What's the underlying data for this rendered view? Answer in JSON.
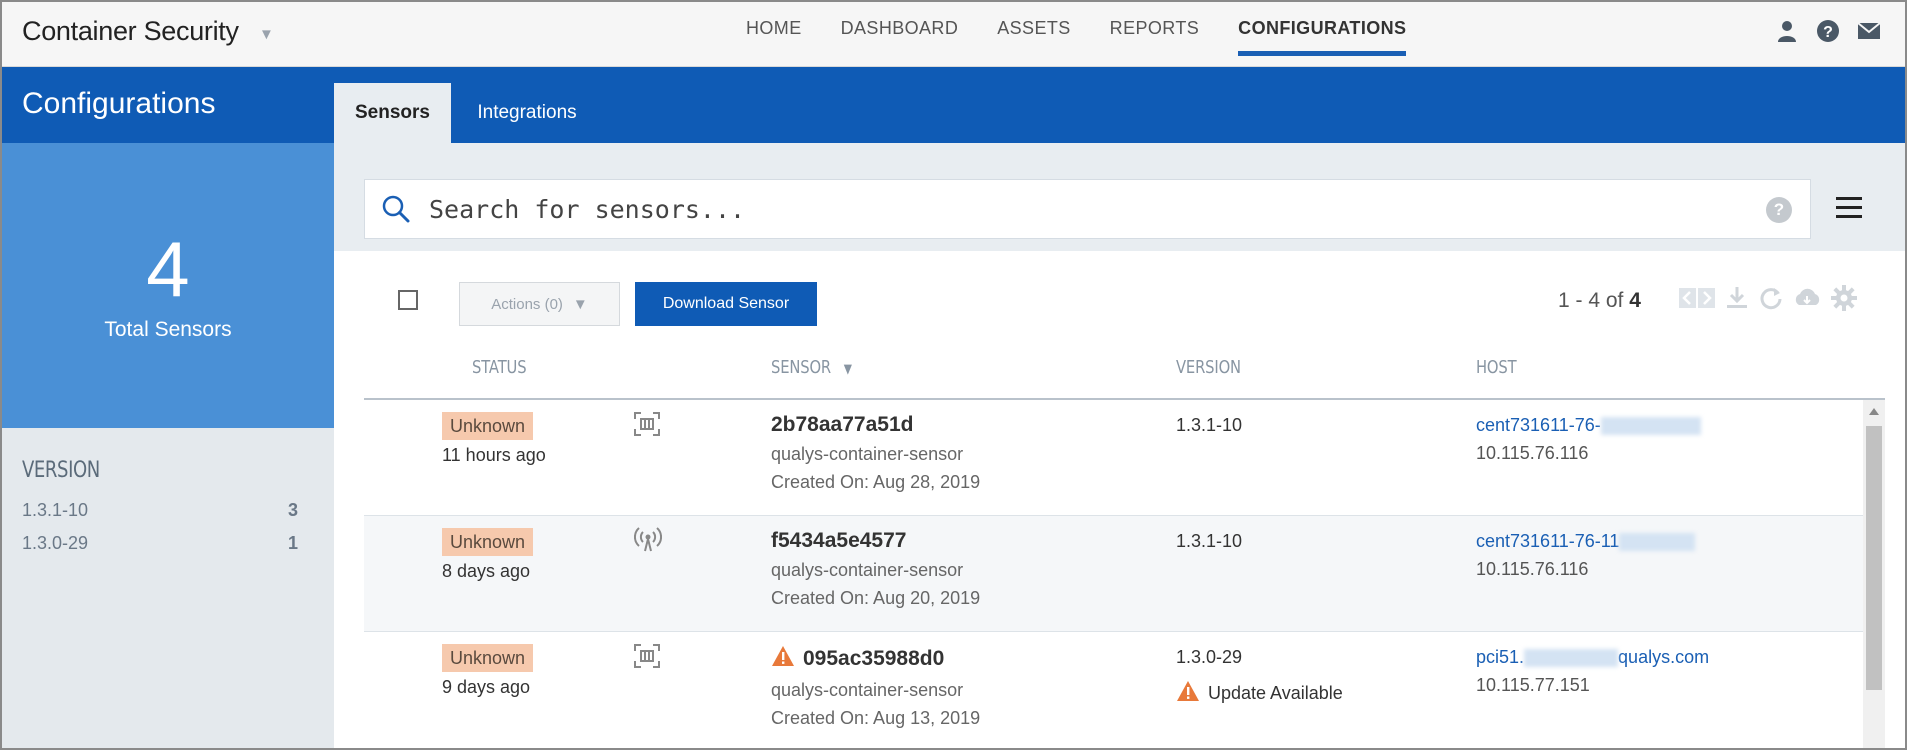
{
  "app": {
    "title": "Container Security"
  },
  "nav": [
    "HOME",
    "DASHBOARD",
    "ASSETS",
    "REPORTS",
    "CONFIGURATIONS"
  ],
  "nav_active": "CONFIGURATIONS",
  "top_icons": [
    "user-icon",
    "help-icon",
    "mail-icon"
  ],
  "sidebar": {
    "title": "Configurations",
    "total": {
      "count": "4",
      "label": "Total Sensors"
    },
    "filter_title": "VERSION",
    "versions": [
      {
        "label": "1.3.1-10",
        "count": "3"
      },
      {
        "label": "1.3.0-29",
        "count": "1"
      }
    ]
  },
  "tabs": [
    {
      "label": "Sensors",
      "active": true
    },
    {
      "label": "Integrations",
      "active": false
    }
  ],
  "search": {
    "placeholder": "Search for sensors...",
    "help": "?"
  },
  "toolbar": {
    "actions_label": "Actions (0)",
    "download_label": "Download Sensor",
    "pager_range": "1 - 4 of",
    "pager_total": "4"
  },
  "table": {
    "headers": {
      "status": "STATUS",
      "sensor": "SENSOR",
      "version": "VERSION",
      "host": "HOST"
    },
    "rows": [
      {
        "status": "Unknown",
        "ago": "11 hours ago",
        "type_icon": "container-icon",
        "id": "2b78aa77a51d",
        "warn": false,
        "name": "qualys-container-sensor",
        "created": "Created On: Aug 28, 2019",
        "version": "1.3.1-10",
        "update": "",
        "host_prefix": "cent731611-76-",
        "host_suffix": "",
        "ip": "10.115.76.116"
      },
      {
        "status": "Unknown",
        "ago": "8 days ago",
        "type_icon": "broadcast-icon",
        "id": "f5434a5e4577",
        "warn": false,
        "name": "qualys-container-sensor",
        "created": "Created On: Aug 20, 2019",
        "version": "1.3.1-10",
        "update": "",
        "host_prefix": "cent731611-76-11",
        "host_suffix": "",
        "ip": "10.115.76.116"
      },
      {
        "status": "Unknown",
        "ago": "9 days ago",
        "type_icon": "container-icon",
        "id": "095ac35988d0",
        "warn": true,
        "name": "qualys-container-sensor",
        "created": "Created On: Aug 13, 2019",
        "version": "1.3.0-29",
        "update": "Update Available",
        "host_prefix": "pci51.",
        "host_suffix": "qualys.com",
        "ip": "10.115.77.151"
      }
    ]
  },
  "colors": {
    "brand_blue": "#0f5bb5",
    "light_blue": "#4a90d6",
    "badge": "#f6c9ad",
    "warning": "#e8793a"
  }
}
